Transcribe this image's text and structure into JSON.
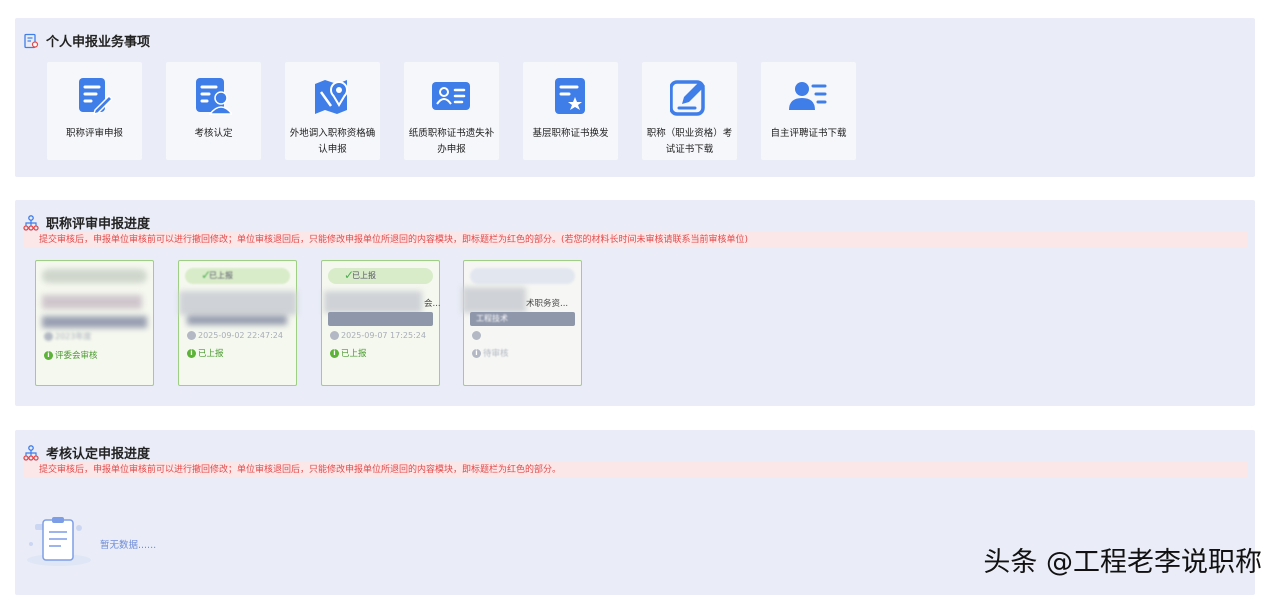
{
  "personal": {
    "title": "个人申报业务事项",
    "tiles": [
      {
        "label": "职称评审申报",
        "icon": "edit-document-icon"
      },
      {
        "label": "考核认定",
        "icon": "document-user-icon"
      },
      {
        "label": "外地调入职称资格确认申报",
        "icon": "map-location-icon"
      },
      {
        "label": "纸质职称证书遗失补办申报",
        "icon": "id-card-icon"
      },
      {
        "label": "基层职称证书换发",
        "icon": "document-star-icon"
      },
      {
        "label": "职称（职业资格）考试证书下载",
        "icon": "pen-square-icon"
      },
      {
        "label": "自主评聘证书下载",
        "icon": "user-list-icon"
      }
    ]
  },
  "progress": {
    "title": "职称评审申报进度",
    "notice": "提交审核后，申报单位审核前可以进行撤回修改；单位审核退回后，只能修改申报单位所退回的内容模块，即标题栏为红色的部分。(若您的材料长时间未审核请联系当前审核单位)",
    "cards": [
      {
        "pill": "",
        "line": "",
        "bar": "",
        "time": "2023年度",
        "status": "评委会审核"
      },
      {
        "pill": "已上报",
        "line": "",
        "bar": "",
        "time": "2025-09-02 22:47:24",
        "status": "已上报"
      },
      {
        "pill": "已上报",
        "line": "会...",
        "bar": "",
        "time": "2025-09-07 17:25:24",
        "status": "已上报"
      },
      {
        "pill": "",
        "line": "术职务资...",
        "bar": "工程技术",
        "time": "",
        "status": "待审核"
      }
    ]
  },
  "assessment": {
    "title": "考核认定申报进度",
    "notice": "提交审核后，申报单位审核前可以进行撤回修改；单位审核退回后，只能修改申报单位所退回的内容模块，即标题栏为红色的部分。",
    "empty_text": "暂无数据......"
  },
  "watermark": "头条 @工程老李说职称",
  "colors": {
    "accent": "#3f7de8",
    "panel": "#eaedf7",
    "notice_bg": "#fbe6e8",
    "notice_text": "#e34b4b",
    "card_border": "#9fcf82"
  }
}
